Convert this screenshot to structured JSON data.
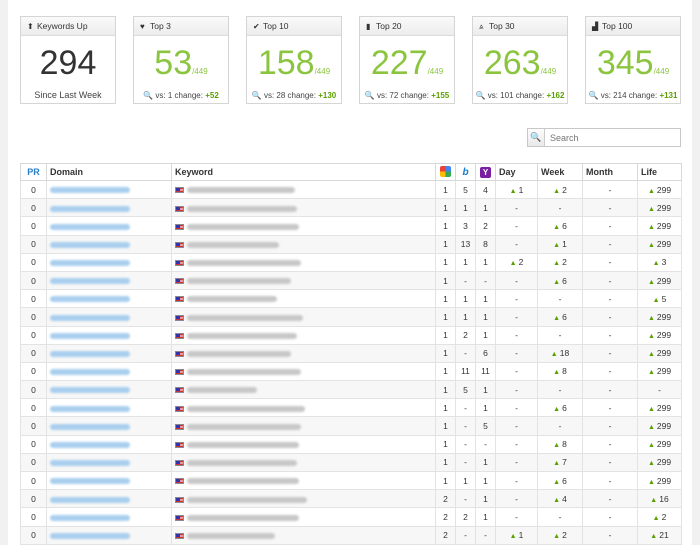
{
  "cards": [
    {
      "icon": "arrow-up-icon",
      "glyph": "⬆",
      "title": "Keywords Up",
      "value": "294",
      "denominator": "",
      "footer": "Since Last Week",
      "vs": "",
      "change": ""
    },
    {
      "icon": "heart-icon",
      "glyph": "♥",
      "title": "Top 3",
      "value": "53",
      "denominator": "/449",
      "footer": "",
      "vs": "vs: 1 change:",
      "change": "+52"
    },
    {
      "icon": "checkmark-icon",
      "glyph": "✔",
      "title": "Top 10",
      "value": "158",
      "denominator": "/449",
      "footer": "",
      "vs": "vs: 28 change:",
      "change": "+130"
    },
    {
      "icon": "bookmark-icon",
      "glyph": "▮",
      "title": "Top 20",
      "value": "227",
      "denominator": "/449",
      "footer": "",
      "vs": "vs: 72 change:",
      "change": "+155"
    },
    {
      "icon": "road-icon",
      "glyph": "⩓",
      "title": "Top 30",
      "value": "263",
      "denominator": "/449",
      "footer": "",
      "vs": "vs: 101 change:",
      "change": "+162"
    },
    {
      "icon": "signal-bars-icon",
      "glyph": "▟",
      "title": "Top 100",
      "value": "345",
      "denominator": "/449",
      "footer": "",
      "vs": "vs: 214 change:",
      "change": "+131"
    }
  ],
  "search": {
    "placeholder": "Search"
  },
  "table": {
    "headers": {
      "pr": "PR",
      "domain": "Domain",
      "keyword": "Keyword",
      "day": "Day",
      "week": "Week",
      "month": "Month",
      "life": "Life"
    },
    "rows": [
      {
        "pr": "0",
        "g": "1",
        "b": "5",
        "y": "4",
        "day": "1",
        "day_up": true,
        "week": "2",
        "week_up": true,
        "month": "-",
        "life": "299",
        "life_up": true
      },
      {
        "pr": "0",
        "g": "1",
        "b": "1",
        "y": "1",
        "day": "-",
        "day_up": false,
        "week": "-",
        "week_up": false,
        "month": "-",
        "life": "299",
        "life_up": true
      },
      {
        "pr": "0",
        "g": "1",
        "b": "3",
        "y": "2",
        "day": "-",
        "day_up": false,
        "week": "6",
        "week_up": true,
        "month": "-",
        "life": "299",
        "life_up": true
      },
      {
        "pr": "0",
        "g": "1",
        "b": "13",
        "y": "8",
        "day": "-",
        "day_up": false,
        "week": "1",
        "week_up": true,
        "month": "-",
        "life": "299",
        "life_up": true
      },
      {
        "pr": "0",
        "g": "1",
        "b": "1",
        "y": "1",
        "day": "2",
        "day_up": true,
        "week": "2",
        "week_up": true,
        "month": "-",
        "life": "3",
        "life_up": true
      },
      {
        "pr": "0",
        "g": "1",
        "b": "-",
        "y": "-",
        "day": "-",
        "day_up": false,
        "week": "6",
        "week_up": true,
        "month": "-",
        "life": "299",
        "life_up": true
      },
      {
        "pr": "0",
        "g": "1",
        "b": "1",
        "y": "1",
        "day": "-",
        "day_up": false,
        "week": "-",
        "week_up": false,
        "month": "-",
        "life": "5",
        "life_up": true
      },
      {
        "pr": "0",
        "g": "1",
        "b": "1",
        "y": "1",
        "day": "-",
        "day_up": false,
        "week": "6",
        "week_up": true,
        "month": "-",
        "life": "299",
        "life_up": true
      },
      {
        "pr": "0",
        "g": "1",
        "b": "2",
        "y": "1",
        "day": "-",
        "day_up": false,
        "week": "-",
        "week_up": false,
        "month": "-",
        "life": "299",
        "life_up": true
      },
      {
        "pr": "0",
        "g": "1",
        "b": "-",
        "y": "6",
        "day": "-",
        "day_up": false,
        "week": "18",
        "week_up": true,
        "month": "-",
        "life": "299",
        "life_up": true
      },
      {
        "pr": "0",
        "g": "1",
        "b": "11",
        "y": "11",
        "day": "-",
        "day_up": false,
        "week": "8",
        "week_up": true,
        "month": "-",
        "life": "299",
        "life_up": true
      },
      {
        "pr": "0",
        "g": "1",
        "b": "5",
        "y": "1",
        "day": "-",
        "day_up": false,
        "week": "-",
        "week_up": false,
        "month": "-",
        "life": "-",
        "life_up": false
      },
      {
        "pr": "0",
        "g": "1",
        "b": "-",
        "y": "1",
        "day": "-",
        "day_up": false,
        "week": "6",
        "week_up": true,
        "month": "-",
        "life": "299",
        "life_up": true
      },
      {
        "pr": "0",
        "g": "1",
        "b": "-",
        "y": "5",
        "day": "-",
        "day_up": false,
        "week": "-",
        "week_up": false,
        "month": "-",
        "life": "299",
        "life_up": true
      },
      {
        "pr": "0",
        "g": "1",
        "b": "-",
        "y": "-",
        "day": "-",
        "day_up": false,
        "week": "8",
        "week_up": true,
        "month": "-",
        "life": "299",
        "life_up": true
      },
      {
        "pr": "0",
        "g": "1",
        "b": "-",
        "y": "1",
        "day": "-",
        "day_up": false,
        "week": "7",
        "week_up": true,
        "month": "-",
        "life": "299",
        "life_up": true
      },
      {
        "pr": "0",
        "g": "1",
        "b": "1",
        "y": "1",
        "day": "-",
        "day_up": false,
        "week": "6",
        "week_up": true,
        "month": "-",
        "life": "299",
        "life_up": true
      },
      {
        "pr": "0",
        "g": "2",
        "b": "-",
        "y": "1",
        "day": "-",
        "day_up": false,
        "week": "4",
        "week_up": true,
        "month": "-",
        "life": "16",
        "life_up": true
      },
      {
        "pr": "0",
        "g": "2",
        "b": "2",
        "y": "1",
        "day": "-",
        "day_up": false,
        "week": "-",
        "week_up": false,
        "month": "-",
        "life": "2",
        "life_up": true
      },
      {
        "pr": "0",
        "g": "2",
        "b": "-",
        "y": "-",
        "day": "1",
        "day_up": true,
        "week": "2",
        "week_up": true,
        "month": "-",
        "life": "21",
        "life_up": true
      }
    ]
  }
}
